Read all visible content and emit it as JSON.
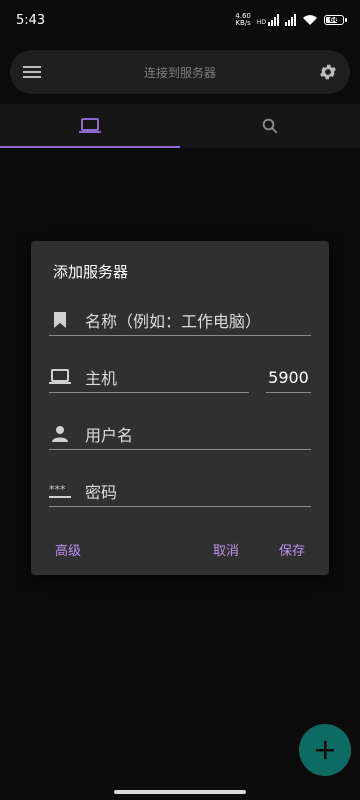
{
  "status": {
    "time": "5:43",
    "net_speed_value": "4.60",
    "net_speed_unit": "KB/s",
    "signal_label": "HD",
    "battery": "66"
  },
  "toolbar": {
    "title": "连接到服务器"
  },
  "tabs": [
    {
      "name": "computer"
    },
    {
      "name": "search"
    }
  ],
  "dialog": {
    "title": "添加服务器",
    "name_placeholder": "名称（例如：工作电脑）",
    "host_placeholder": "主机",
    "port_value": "5900",
    "username_placeholder": "用户名",
    "password_placeholder": "密码",
    "advanced_label": "高级",
    "cancel_label": "取消",
    "save_label": "保存"
  },
  "colors": {
    "accent": "#8f6ad0",
    "button_text": "#b892ef",
    "fab": "#0c6b62",
    "dialog_bg": "#303030"
  }
}
